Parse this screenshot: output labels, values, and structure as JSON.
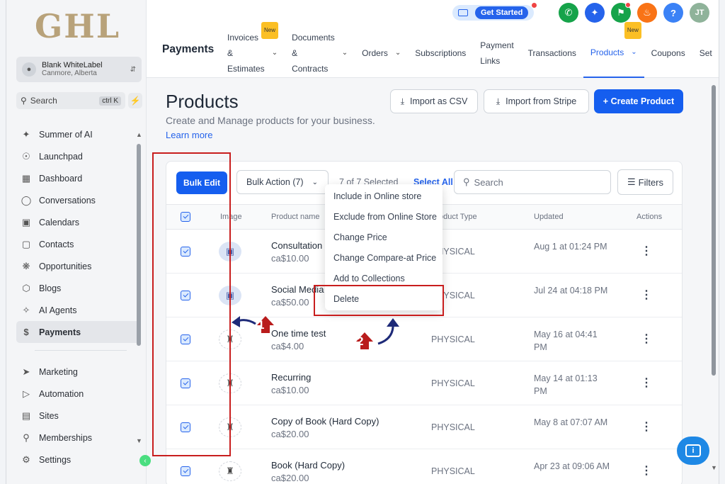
{
  "brand": {
    "logo_text": "GHL"
  },
  "account": {
    "name": "Blank WhiteLabel",
    "location": "Canmore, Alberta"
  },
  "sidebar": {
    "search_label": "Search",
    "search_shortcut": "ctrl K",
    "items": [
      {
        "label": "Summer of AI",
        "icon": "sparkles-icon"
      },
      {
        "label": "Launchpad",
        "icon": "rocket-icon"
      },
      {
        "label": "Dashboard",
        "icon": "grid-icon"
      },
      {
        "label": "Conversations",
        "icon": "chat-icon"
      },
      {
        "label": "Calendars",
        "icon": "calendar-icon"
      },
      {
        "label": "Contacts",
        "icon": "contacts-icon"
      },
      {
        "label": "Opportunities",
        "icon": "opportunities-icon"
      },
      {
        "label": "Blogs",
        "icon": "cube-icon"
      },
      {
        "label": "AI Agents",
        "icon": "ai-icon"
      },
      {
        "label": "Payments",
        "icon": "dollar-icon"
      }
    ],
    "items2": [
      {
        "label": "Marketing",
        "icon": "send-icon"
      },
      {
        "label": "Automation",
        "icon": "play-icon"
      },
      {
        "label": "Sites",
        "icon": "sites-icon"
      },
      {
        "label": "Memberships",
        "icon": "award-icon"
      },
      {
        "label": "Settings",
        "icon": "gear-icon"
      }
    ]
  },
  "topbar": {
    "get_started": "Get Started",
    "page_name": "Payments",
    "tabs": [
      {
        "line1": "Invoices",
        "line2": "&",
        "line3": "Estimates",
        "badge": "New"
      },
      {
        "line1": "Documents",
        "line2": "&",
        "line3": "Contracts"
      },
      {
        "label": "Orders"
      },
      {
        "label": "Subscriptions"
      },
      {
        "line1": "Payment",
        "line2": "Links"
      },
      {
        "label": "Transactions"
      },
      {
        "label": "Products",
        "badge": "New"
      },
      {
        "label": "Coupons"
      },
      {
        "label": "Set"
      }
    ],
    "avatar_initials": "JT"
  },
  "page": {
    "title": "Products",
    "subtitle": "Create and Manage products for your business.",
    "learn_more": "Learn more",
    "import_csv": "Import as CSV",
    "import_stripe": "Import from Stripe",
    "create_product": "+  Create Product"
  },
  "table": {
    "bulk_edit": "Bulk Edit",
    "bulk_action": "Bulk Action (7)",
    "selected": "7 of 7 Selected",
    "select_all": "Select All",
    "search_placeholder": "Search",
    "filters": "Filters",
    "headers": {
      "image": "Image",
      "name": "Product name",
      "type": "Product Type",
      "updated": "Updated",
      "actions": "Actions"
    },
    "rows": [
      {
        "name": "Consultation",
        "price": "ca$10.00",
        "type": "PHYSICAL",
        "updated": "Aug 1 at 01:24 PM"
      },
      {
        "name": "Social Media",
        "price": "ca$50.00",
        "type": "PHYSICAL",
        "updated": "Jul 24 at 04:18 PM"
      },
      {
        "name": "One time test",
        "price": "ca$4.00",
        "type": "PHYSICAL",
        "updated": "May 16 at 04:41 PM"
      },
      {
        "name": "Recurring",
        "price": "ca$10.00",
        "type": "PHYSICAL",
        "updated": "May 14 at 01:13 PM"
      },
      {
        "name": "Copy of Book (Hard Copy)",
        "price": "ca$20.00",
        "type": "PHYSICAL",
        "updated": "May 8 at 07:07 AM"
      },
      {
        "name": "Book (Hard Copy)",
        "price": "ca$20.00",
        "type": "PHYSICAL",
        "updated": "Apr 23 at 09:06 AM"
      }
    ]
  },
  "bulk_menu": [
    "Include in Online store",
    "Exclude from Online Store",
    "Change Price",
    "Change Compare-at Price",
    "Add to Collections",
    "Delete"
  ],
  "annotations": {
    "step1": "1",
    "step2": "2"
  },
  "colors": {
    "primary": "#155eef",
    "accent_annotation": "#c81e1e",
    "arrow": "#1e2a78"
  }
}
